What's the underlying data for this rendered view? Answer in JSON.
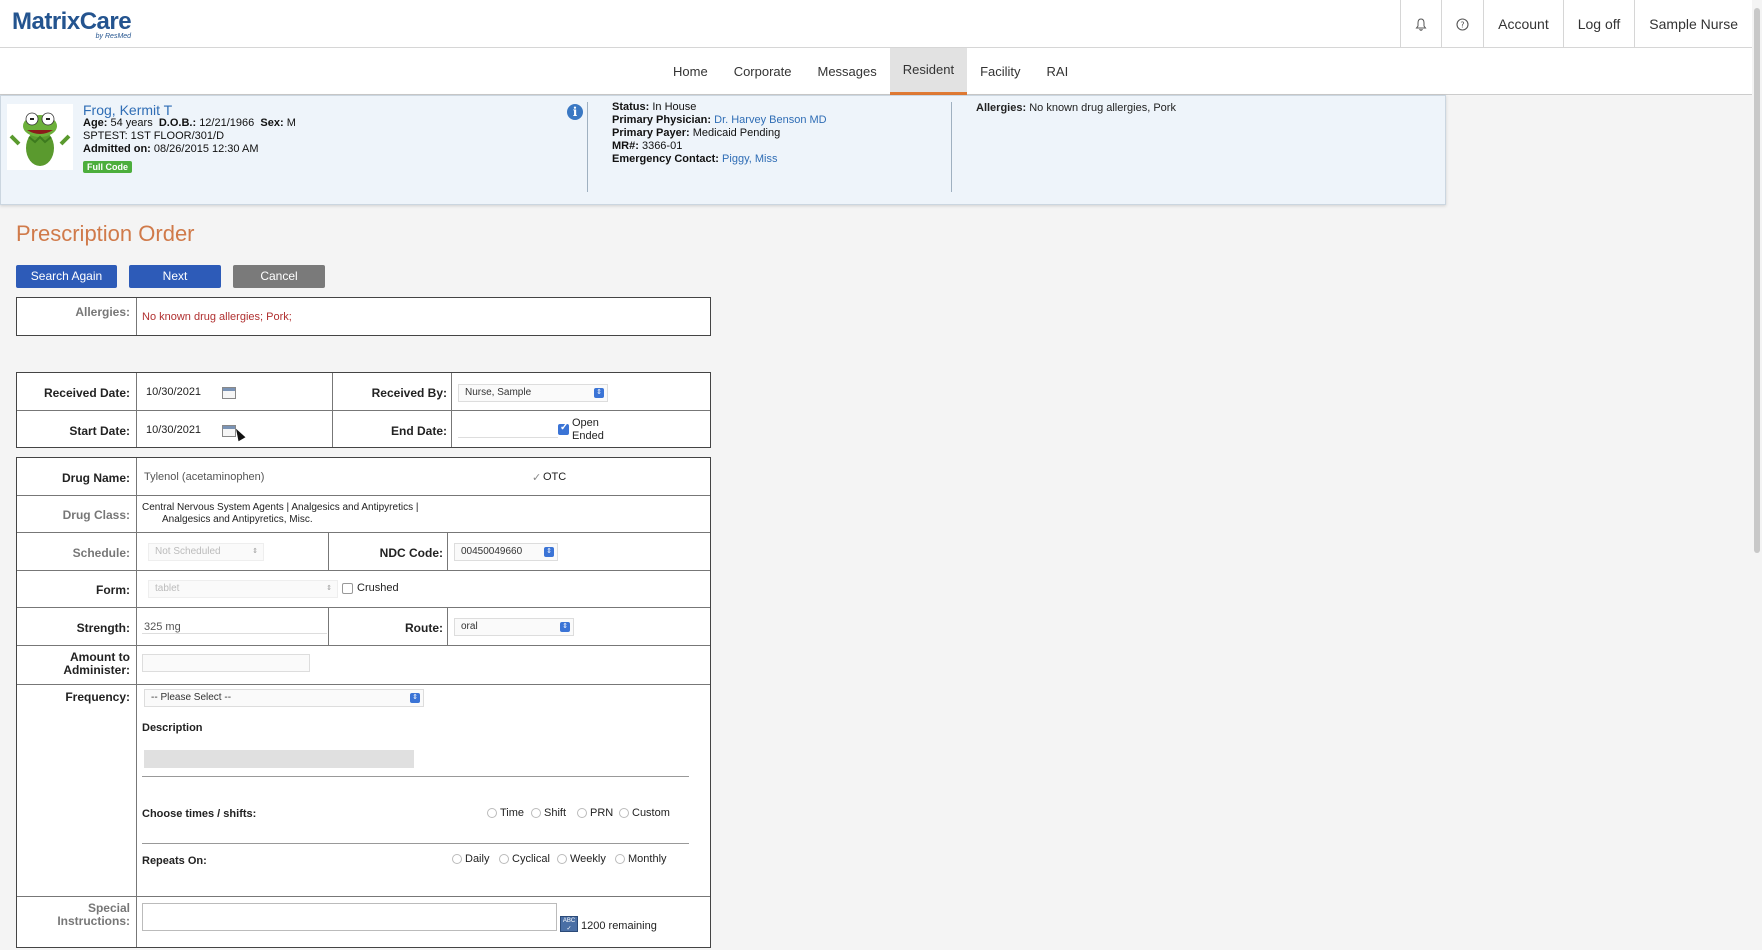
{
  "header": {
    "logo_text": "MatrixCare",
    "logo_sub": "by ResMed",
    "account_label": "Account",
    "logoff_label": "Log off",
    "user_name": "Sample Nurse"
  },
  "nav": {
    "tabs": [
      {
        "label": "Home"
      },
      {
        "label": "Corporate"
      },
      {
        "label": "Messages"
      },
      {
        "label": "Resident"
      },
      {
        "label": "Facility"
      },
      {
        "label": "RAI"
      }
    ]
  },
  "resident": {
    "name": "Frog, Kermit T",
    "age_label": "Age:",
    "age": "54 years",
    "dob_label": "D.O.B.:",
    "dob": "12/21/1966",
    "sex_label": "Sex:",
    "sex": "M",
    "location": "SPTEST: 1ST FLOOR/301/D",
    "admitted_label": "Admitted on:",
    "admitted": "08/26/2015 12:30 AM",
    "code_badge": "Full Code",
    "status_label": "Status:",
    "status": "In House",
    "physician_label": "Primary Physician:",
    "physician": "Dr. Harvey Benson MD",
    "payer_label": "Primary Payer:",
    "payer": "Medicaid Pending",
    "mr_label": "MR#:",
    "mr": "3366-01",
    "emergency_label": "Emergency Contact:",
    "emergency": "Piggy, Miss",
    "allergies_label": "Allergies:",
    "allergies": "No known drug allergies, Pork"
  },
  "page": {
    "title": "Prescription Order",
    "search_again": "Search Again",
    "next": "Next",
    "cancel": "Cancel"
  },
  "allergy_box": {
    "label": "Allergies:",
    "value": "No known drug allergies; Pork;"
  },
  "form": {
    "received_date_label": "Received Date:",
    "received_date": "10/30/2021",
    "received_by_label": "Received By:",
    "received_by": "Nurse, Sample",
    "start_date_label": "Start Date:",
    "start_date": "10/30/2021",
    "end_date_label": "End Date:",
    "open_ended": "Open Ended",
    "drug_name_label": "Drug Name:",
    "drug_name": "Tylenol (acetaminophen)",
    "otc": "OTC",
    "drug_class_label": "Drug Class:",
    "drug_class_1": "Central Nervous System Agents |  Analgesics and Antipyretics |",
    "drug_class_2": "Analgesics and Antipyretics, Misc.",
    "schedule_label": "Schedule:",
    "schedule": "Not Scheduled",
    "ndc_label": "NDC Code:",
    "ndc": "00450049660",
    "form_label": "Form:",
    "form_value": "tablet",
    "crushed": "Crushed",
    "strength_label": "Strength:",
    "strength": "325 mg",
    "route_label": "Route:",
    "route": "oral",
    "amount_label_1": "Amount to",
    "amount_label_2": "Administer:",
    "frequency_label": "Frequency:",
    "frequency": "-- Please Select --",
    "description_label": "Description",
    "choose_times_label": "Choose times / shifts:",
    "times_options": [
      "Time",
      "Shift",
      "PRN",
      "Custom"
    ],
    "repeats_label": "Repeats On:",
    "repeats_options": [
      "Daily",
      "Cyclical",
      "Weekly",
      "Monthly"
    ],
    "special_label_1": "Special",
    "special_label_2": "Instructions:",
    "remaining": "1200 remaining"
  },
  "colors": {
    "brand_blue": "#24548f",
    "brand_orange": "#e06a2b",
    "button_blue": "#2d5bb8",
    "title_orange": "#d07a4a",
    "allergy_red": "#b03030"
  }
}
